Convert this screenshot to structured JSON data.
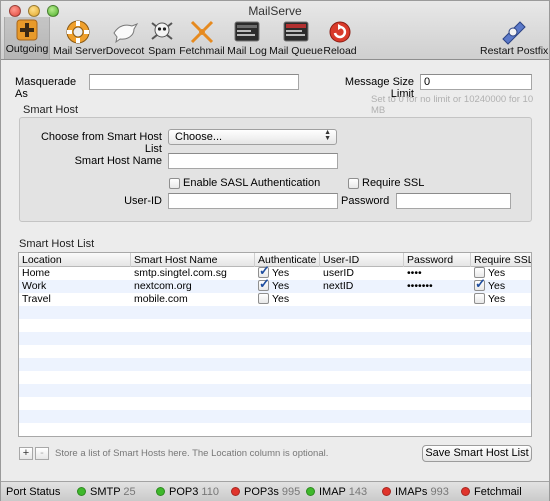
{
  "window": {
    "title": "MailServe"
  },
  "toolbar": [
    {
      "label": "Outgoing",
      "icon": "plus-icon"
    },
    {
      "label": "Mail Server",
      "icon": "lifebuoy-icon"
    },
    {
      "label": "Dovecot",
      "icon": "dove-icon"
    },
    {
      "label": "Spam",
      "icon": "skull-icon"
    },
    {
      "label": "Fetchmail",
      "icon": "fetch-arrows-icon"
    },
    {
      "label": "Mail Log",
      "icon": "console-icon"
    },
    {
      "label": "Mail Queue",
      "icon": "queue-console-icon"
    },
    {
      "label": "Reload",
      "icon": "reload-icon"
    },
    {
      "label": "Restart Postfix",
      "icon": "postfix-icon"
    }
  ],
  "form": {
    "masquerade_label": "Masquerade As",
    "masquerade_value": "",
    "size_limit_label": "Message Size Limit",
    "size_limit_value": "0",
    "size_hint": "Set to 0 for no limit or 10240000 for 10 MB"
  },
  "smart_host": {
    "group_title": "Smart Host",
    "choose_label": "Choose from Smart Host List",
    "choose_value": "Choose...",
    "name_label": "Smart Host Name",
    "name_value": "",
    "sasl_label": "Enable SASL Authentication",
    "sasl_checked": false,
    "ssl_label": "Require SSL",
    "ssl_checked": false,
    "userid_label": "User-ID",
    "userid_value": "",
    "password_label": "Password",
    "password_value": ""
  },
  "list": {
    "title": "Smart Host List",
    "columns": [
      "Location",
      "Smart Host Name",
      "Authenticate",
      "User-ID",
      "Password",
      "Require SSL"
    ],
    "rows": [
      {
        "location": "Home",
        "host": "smtp.singtel.com.sg",
        "auth": "Yes",
        "auth_checked": true,
        "userid": "userID",
        "password": "••••",
        "ssl": "Yes",
        "ssl_checked": false
      },
      {
        "location": "Work",
        "host": "nextcom.org",
        "auth": "Yes",
        "auth_checked": true,
        "userid": "nextID",
        "password": "•••••••",
        "ssl": "Yes",
        "ssl_checked": true
      },
      {
        "location": "Travel",
        "host": "mobile.com",
        "auth": "Yes",
        "auth_checked": false,
        "userid": "",
        "password": "",
        "ssl": "Yes",
        "ssl_checked": false
      }
    ],
    "add_label": "+",
    "remove_label": "-",
    "footer_hint": "Store a list of Smart Hosts here. The Location column is optional.",
    "save_label": "Save Smart Host List"
  },
  "status": {
    "label": "Port Status",
    "items": [
      {
        "name": "SMTP",
        "port": "25",
        "color": "#3fb82c"
      },
      {
        "name": "POP3",
        "port": "110",
        "color": "#3fb82c"
      },
      {
        "name": "POP3s",
        "port": "995",
        "color": "#e0332b"
      },
      {
        "name": "IMAP",
        "port": "143",
        "color": "#3fb82c"
      },
      {
        "name": "IMAPs",
        "port": "993",
        "color": "#e0332b"
      },
      {
        "name": "Fetchmail",
        "port": "",
        "color": "#e0332b"
      }
    ]
  }
}
